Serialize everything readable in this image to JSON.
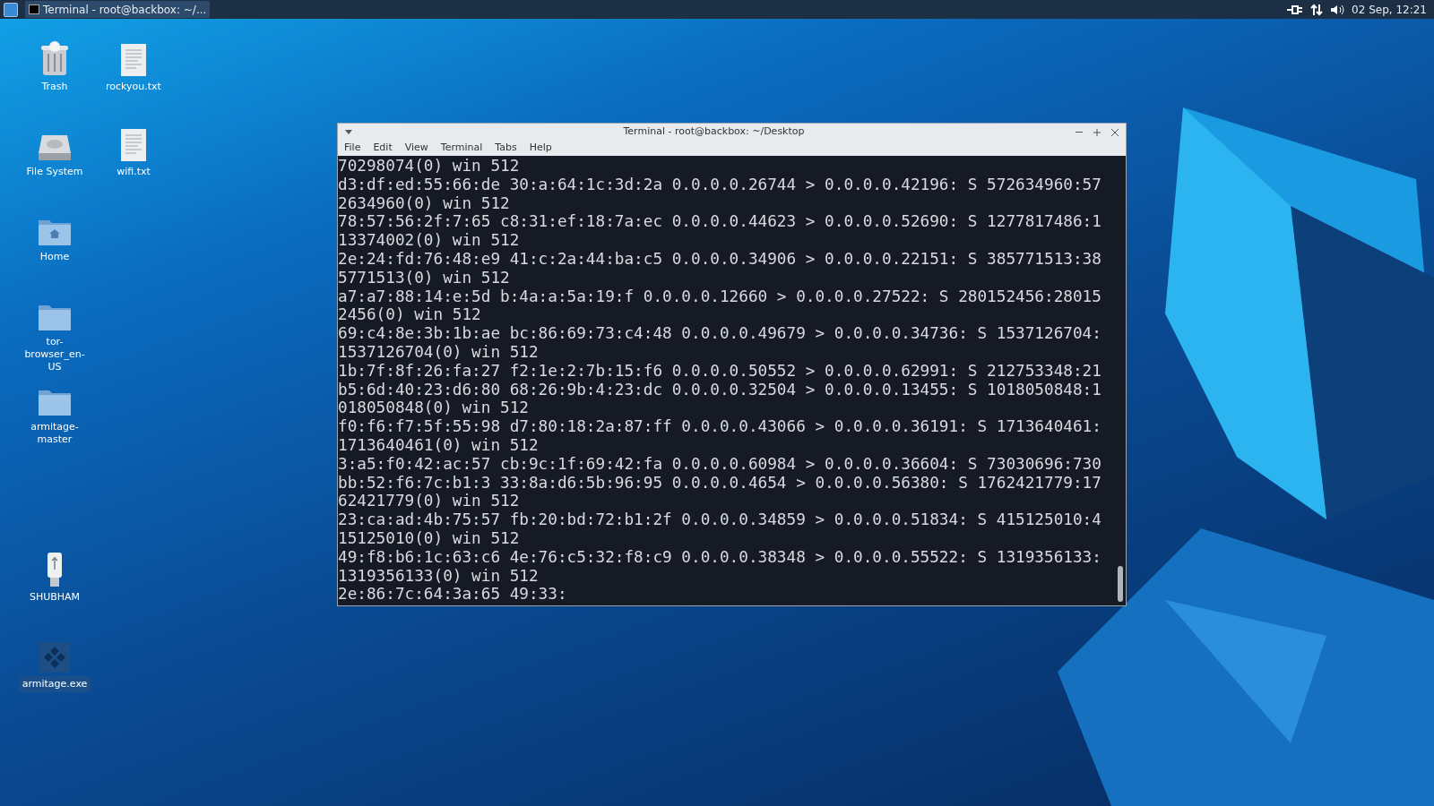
{
  "taskbar": {
    "window_button": "Terminal - root@backbox: ~/...",
    "clock": "02 Sep, 12:21"
  },
  "desktop_icons": [
    {
      "label": "Trash",
      "kind": "trash",
      "selected": false
    },
    {
      "label": "File System",
      "kind": "drive",
      "selected": false
    },
    {
      "label": "Home",
      "kind": "home",
      "selected": false
    },
    {
      "label": "tor-browser_en-US",
      "kind": "folder",
      "selected": false
    },
    {
      "label": "armitage-master",
      "kind": "folder",
      "selected": false
    },
    {
      "label": "SHUBHAM",
      "kind": "usb",
      "selected": false
    },
    {
      "label": "armitage.exe",
      "kind": "exe",
      "selected": true
    },
    {
      "label": "rockyou.txt",
      "kind": "text",
      "selected": false
    },
    {
      "label": "wifi.txt",
      "kind": "text",
      "selected": false
    }
  ],
  "terminal": {
    "title": "Terminal - root@backbox: ~/Desktop",
    "menu": [
      "File",
      "Edit",
      "View",
      "Terminal",
      "Tabs",
      "Help"
    ],
    "lines": [
      "70298074(0) win 512",
      "d3:df:ed:55:66:de 30:a:64:1c:3d:2a 0.0.0.0.26744 > 0.0.0.0.42196: S 572634960:57",
      "2634960(0) win 512",
      "78:57:56:2f:7:65 c8:31:ef:18:7a:ec 0.0.0.0.44623 > 0.0.0.0.52690: S 1277817486:1",
      "13374002(0) win 512",
      "2e:24:fd:76:48:e9 41:c:2a:44:ba:c5 0.0.0.0.34906 > 0.0.0.0.22151: S 385771513:38",
      "5771513(0) win 512",
      "a7:a7:88:14:e:5d b:4a:a:5a:19:f 0.0.0.0.12660 > 0.0.0.0.27522: S 280152456:28015",
      "2456(0) win 512",
      "69:c4:8e:3b:1b:ae bc:86:69:73:c4:48 0.0.0.0.49679 > 0.0.0.0.34736: S 1537126704:",
      "1537126704(0) win 512",
      "1b:7f:8f:26:fa:27 f2:1e:2:7b:15:f6 0.0.0.0.50552 > 0.0.0.0.62991: S 212753348:21",
      "b5:6d:40:23:d6:80 68:26:9b:4:23:dc 0.0.0.0.32504 > 0.0.0.0.13455: S 1018050848:1",
      "018050848(0) win 512",
      "f0:f6:f7:5f:55:98 d7:80:18:2a:87:ff 0.0.0.0.43066 > 0.0.0.0.36191: S 1713640461:",
      "1713640461(0) win 512",
      "3:a5:f0:42:ac:57 cb:9c:1f:69:42:fa 0.0.0.0.60984 > 0.0.0.0.36604: S 73030696:730",
      "bb:52:f6:7c:b1:3 33:8a:d6:5b:96:95 0.0.0.0.4654 > 0.0.0.0.56380: S 1762421779:17",
      "62421779(0) win 512",
      "23:ca:ad:4b:75:57 fb:20:bd:72:b1:2f 0.0.0.0.34859 > 0.0.0.0.51834: S 415125010:4",
      "15125010(0) win 512",
      "49:f8:b6:1c:63:c6 4e:76:c5:32:f8:c9 0.0.0.0.38348 > 0.0.0.0.55522: S 1319356133:",
      "1319356133(0) win 512",
      "2e:86:7c:64:3a:65 49:33:"
    ]
  }
}
